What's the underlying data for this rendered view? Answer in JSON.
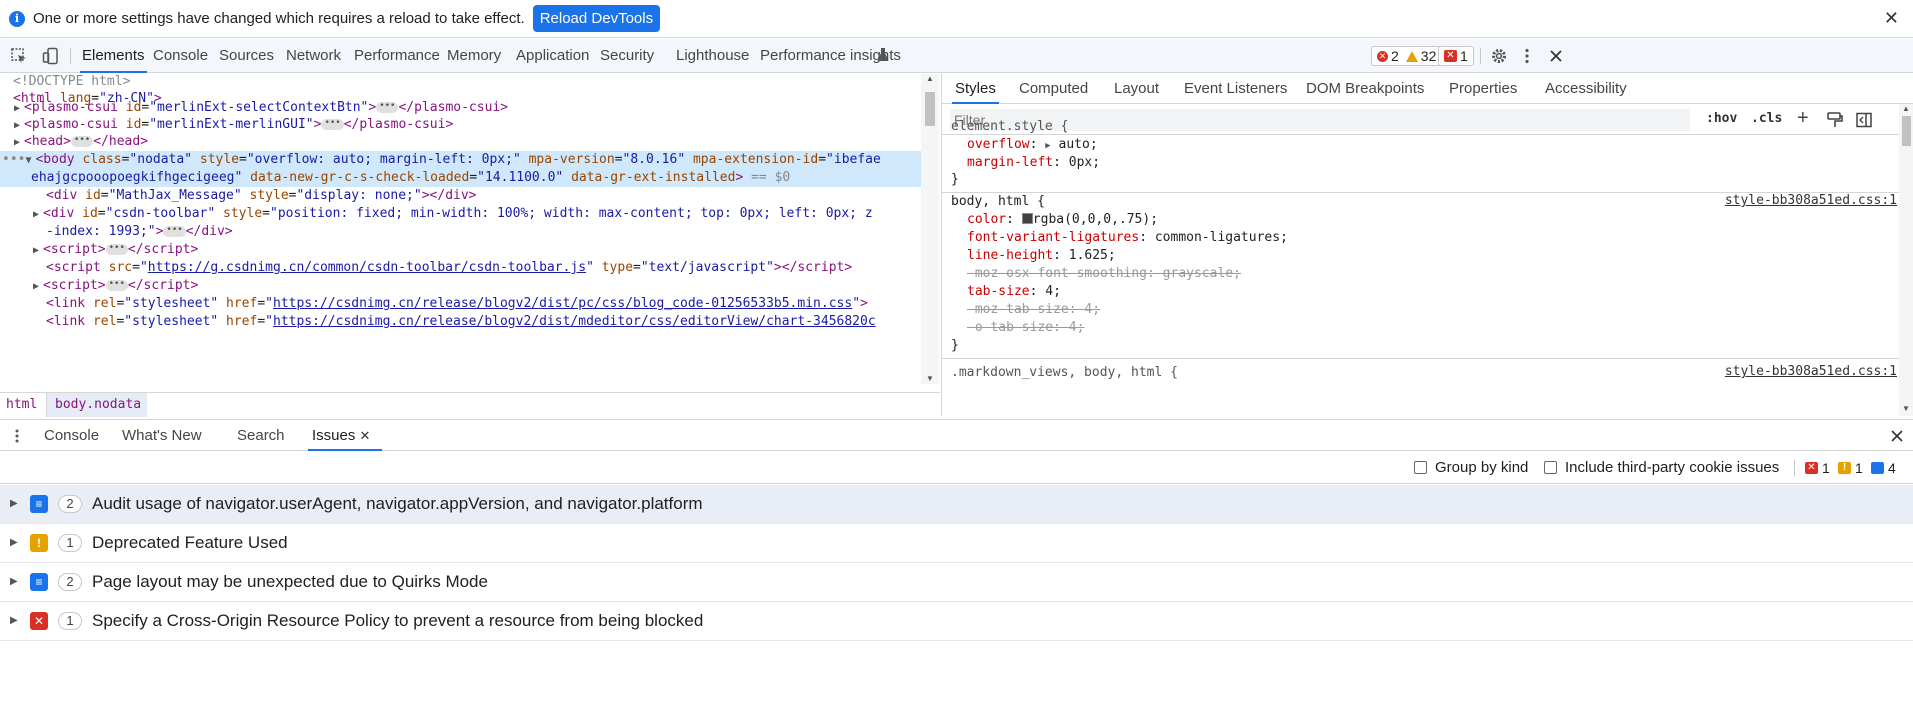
{
  "infobar": {
    "message": "One or more settings have changed which requires a reload to take effect.",
    "button": "Reload DevTools",
    "close": "✕"
  },
  "main_tabs": [
    "Elements",
    "Console",
    "Sources",
    "Network",
    "Performance",
    "Memory",
    "Application",
    "Security",
    "Lighthouse",
    "Performance insights"
  ],
  "counts": {
    "errors": "2",
    "warnings": "32",
    "issues": "1"
  },
  "dom": {
    "l1": "<!DOCTYPE html>",
    "l2_tag": "<html",
    "l2_attr": "lang",
    "l2_val": "\"zh-CN\"",
    "l3_id": "\"merlinExt-selectContextBtn\"",
    "l4_id": "\"merlinExt-merlinGUI\"",
    "tag_plasmo": "plasmo-csui",
    "tag_head": "head",
    "body_class": "\"nodata\"",
    "body_style": "\"overflow: auto; margin-left: 0px;\"",
    "body_mpa_version": "\"8.0.16\"",
    "body_mpa_ext_start": "\"ibefae",
    "body_mpa_ext_end": "ehajgcpooopoegkifhgecigeeg\"",
    "body_check": "\"14.1100.0\"",
    "body_marker": "== $0",
    "mathjax_id": "\"MathJax_Message\"",
    "mathjax_style": "\"display: none;\"",
    "toolbar_id": "\"csdn-toolbar\"",
    "toolbar_style": "\"position: fixed; min-width: 100%; width: max-content; top: 0px; left: 0px; z",
    "toolbar_style2": "-index: 1993;\"",
    "script_src": "https://g.csdnimg.cn/common/csdn-toolbar/csdn-toolbar.js",
    "script_type": "\"text/javascript\"",
    "link1": "https://csdnimg.cn/release/blogv2/dist/pc/css/blog_code-01256533b5.min.css",
    "link2": "https://csdnimg.cn/release/blogv2/dist/mdeditor/css/editorView/chart-3456820c"
  },
  "breadcrumbs": [
    "html",
    "body.nodata"
  ],
  "style_tabs": [
    "Styles",
    "Computed",
    "Layout",
    "Event Listeners",
    "DOM Breakpoints",
    "Properties",
    "Accessibility"
  ],
  "filter_placeholder": "Filter",
  "style_tools": {
    "hov": ":hov",
    "cls": ".cls",
    "plus": "+"
  },
  "styles": {
    "element_style": "element.style {",
    "overflow_prop": "overflow",
    "overflow_val": "auto;",
    "margin_prop": "margin-left",
    "margin_val": "0px;",
    "close": "}",
    "body_sel": "body, html {",
    "body_src": "style-bb308a51ed.css:1",
    "color_prop": "color",
    "color_val": "rgba(0,0,0,.75);",
    "fvl_prop": "font-variant-ligatures",
    "fvl_val": "common-ligatures;",
    "lh_prop": "line-height",
    "lh_val": "1.625;",
    "moz_font": "-moz-osx-font-smoothing: grayscale;",
    "tab_prop": "tab-size",
    "tab_val": "4;",
    "moz_tab": "-moz-tab-size: 4;",
    "o_tab": "-o-tab-size: 4;",
    "md_sel": ".markdown_views, body, html {",
    "md_src": "style-bb308a51ed.css:1"
  },
  "drawer_tabs": [
    "Console",
    "What's New",
    "Search",
    "Issues"
  ],
  "issues_toolbar": {
    "group_by_kind": "Group by kind",
    "third_party": "Include third-party cookie issues",
    "errors": "1",
    "warnings": "1",
    "info": "4"
  },
  "issues": [
    {
      "kind": "info",
      "count": "2",
      "title": "Audit usage of navigator.userAgent, navigator.appVersion, and navigator.platform"
    },
    {
      "kind": "warning",
      "count": "1",
      "title": "Deprecated Feature Used"
    },
    {
      "kind": "info",
      "count": "2",
      "title": "Page layout may be unexpected due to Quirks Mode"
    },
    {
      "kind": "error",
      "count": "1",
      "title": "Specify a Cross-Origin Resource Policy to prevent a resource from being blocked"
    }
  ],
  "colors": {
    "accent": "#1a73e8",
    "error": "#d93025",
    "warning": "#e8a200",
    "info": "#1a73e8",
    "selection": "#cfe8fc"
  }
}
